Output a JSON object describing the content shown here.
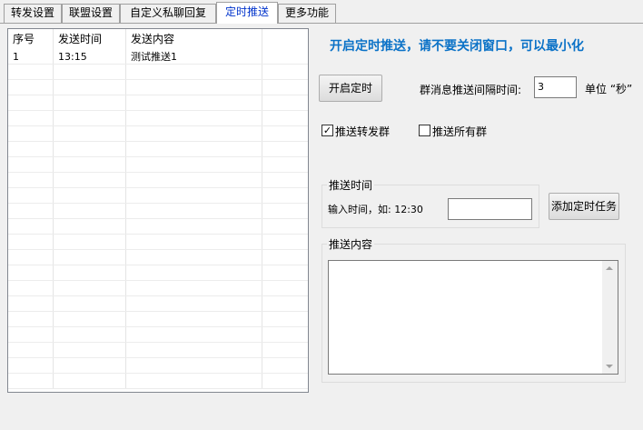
{
  "tabs": [
    {
      "label": "转发设置",
      "active": false
    },
    {
      "label": "联盟设置",
      "active": false
    },
    {
      "label": "自定义私聊回复",
      "active": false
    },
    {
      "label": "定时推送",
      "active": true
    },
    {
      "label": "更多功能",
      "active": false
    }
  ],
  "list": {
    "columns": [
      "序号",
      "发送时间",
      "发送内容"
    ],
    "rows": [
      {
        "index": "1",
        "time": "13:15",
        "content": "测试推送1"
      }
    ]
  },
  "notice": "开启定时推送，请不要关闭窗口，可以最小化",
  "timer_button": "开启定时",
  "interval": {
    "label": "群消息推送间隔时间:",
    "value": "3",
    "unit": "单位 “秒”"
  },
  "checkboxes": {
    "forward_groups": {
      "label": "推送转发群",
      "checked": true,
      "mark": "✓"
    },
    "all_groups": {
      "label": "推送所有群",
      "checked": false
    }
  },
  "time_group": {
    "title": "推送时间",
    "input_label": "输入时间，如: 12:30",
    "value": "",
    "add_button": "添加定时任务"
  },
  "content_group": {
    "title": "推送内容",
    "value": ""
  }
}
